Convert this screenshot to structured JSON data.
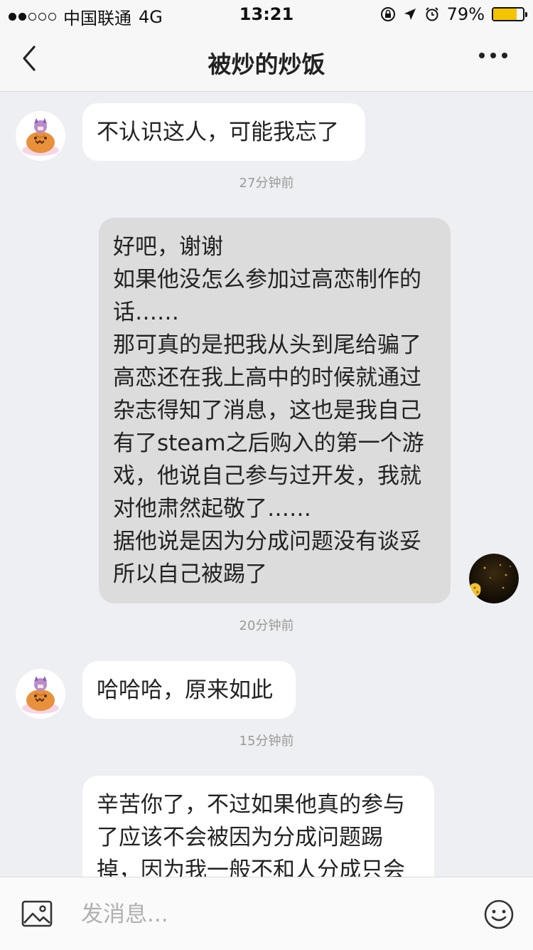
{
  "status_bar": {
    "carrier": "中国联通",
    "network": "4G",
    "time": "13:21",
    "battery_percent": "79%",
    "battery_level": 0.79,
    "signal_dots_filled": 2,
    "signal_dots_total": 5,
    "battery_color": "#f5c400"
  },
  "nav": {
    "title": "被炒的炒饭",
    "back_icon": "chevron-left-icon",
    "more_icon": "more-dots-icon"
  },
  "messages": [
    {
      "side": "in",
      "text": "不认识这人，可能我忘了"
    },
    {
      "side": "out",
      "text": "好吧，谢谢\n如果他没怎么参加过高恋制作的话……\n那可真的是把我从头到尾给骗了\n高恋还在我上高中的时候就通过杂志得知了消息，这也是我自己有了steam之后购入的第一个游戏，他说自己参与过开发，我就对他肃然起敬了……\n据他说是因为分成问题没有谈妥所以自己被踢了"
    },
    {
      "side": "in",
      "text": "哈哈哈，原来如此"
    },
    {
      "side": "in",
      "text": "辛苦你了，不过如果他真的参与了应该不会被因为分成问题踢掉，因为我一般不和人分成只会给"
    }
  ],
  "timestamps": [
    "27分钟前",
    "20分钟前",
    "15分钟前"
  ],
  "input_bar": {
    "placeholder": "发消息...",
    "image_icon": "image-icon",
    "emoji_icon": "emoji-icon"
  }
}
